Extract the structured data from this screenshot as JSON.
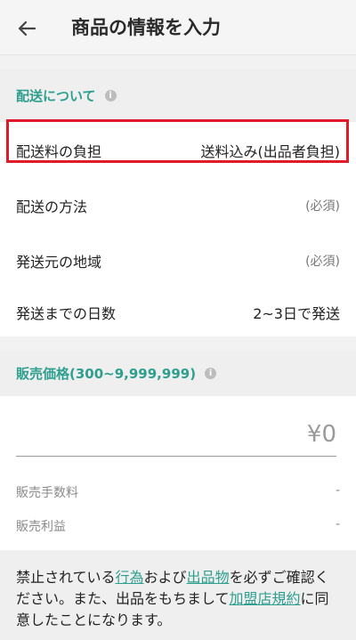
{
  "header": {
    "title": "商品の情報を入力",
    "back_icon": "arrow-left-icon"
  },
  "shipping": {
    "heading": "配送について",
    "info_icon": "i",
    "rows": [
      {
        "label": "配送料の負担",
        "value": "送料込み(出品者負担)"
      },
      {
        "label": "配送の方法",
        "value": "(必須)"
      },
      {
        "label": "発送元の地域",
        "value": "(必須)"
      },
      {
        "label": "発送までの日数",
        "value": "2~3日で発送"
      }
    ]
  },
  "price": {
    "heading": "販売価格(300~9,999,999)",
    "info_icon": "i",
    "value": "¥0",
    "fee_label": "販売手数料",
    "fee_value": "-",
    "profit_label": "販売利益",
    "profit_value": "-"
  },
  "notice": {
    "part1": "禁止されている",
    "link1": "行為",
    "part2": "および",
    "link2": "出品物",
    "part3": "を必ずご確認ください。また、出品をもちまして",
    "link3": "加盟店規約",
    "part4": "に同意したことになります。"
  },
  "colors": {
    "accent": "#2e9f8f",
    "highlight": "#e01a2b"
  }
}
